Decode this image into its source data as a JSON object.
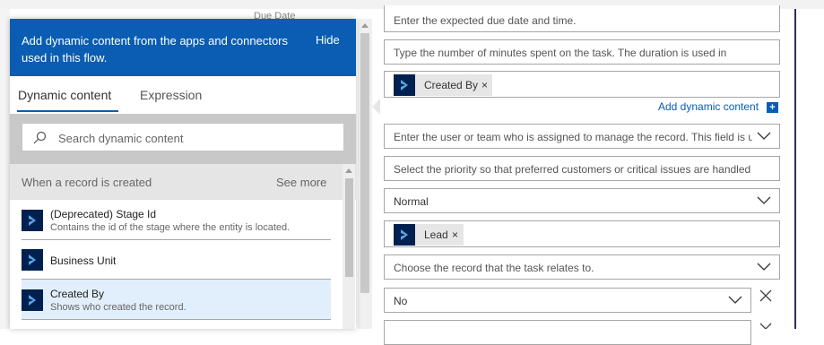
{
  "behind_label": "Due Date",
  "panel": {
    "header_message": "Add dynamic content from the apps and connectors used in this flow.",
    "hide_label": "Hide",
    "tabs": [
      {
        "label": "Dynamic content",
        "active": true
      },
      {
        "label": "Expression",
        "active": false
      }
    ],
    "search_placeholder": "Search dynamic content",
    "section": {
      "title": "When a record is created",
      "see_more": "See more"
    },
    "items": [
      {
        "name": "(Deprecated) Stage Id",
        "description": "Contains the id of the stage where the entity is located.",
        "icon": "dynamics-icon",
        "selected": false
      },
      {
        "name": "Business Unit",
        "description": "",
        "icon": "dynamics-icon",
        "selected": false
      },
      {
        "name": "Created By",
        "description": "Shows who created the record.",
        "icon": "dynamics-icon",
        "selected": true
      }
    ]
  },
  "form": {
    "due_date_placeholder": "Enter the expected due date and time.",
    "duration_placeholder": "Type the number of minutes spent on the task. The duration is used in",
    "created_by_token": "Created By",
    "token_remove": "×",
    "add_dynamic_label": "Add dynamic content",
    "add_dynamic_icon": "+",
    "owner_placeholder": "Enter the user or team who is assigned to manage the record. This field is u",
    "priority_placeholder": "Select the priority so that preferred customers or critical issues are handled",
    "priority_value": "Normal",
    "lead_token": "Lead",
    "regarding_placeholder": "Choose the record that the task relates to.",
    "yesno_value": "No"
  },
  "colors": {
    "accent": "#0a5db2",
    "icon_bg": "#002050",
    "selected_bg": "#e1eefb"
  }
}
